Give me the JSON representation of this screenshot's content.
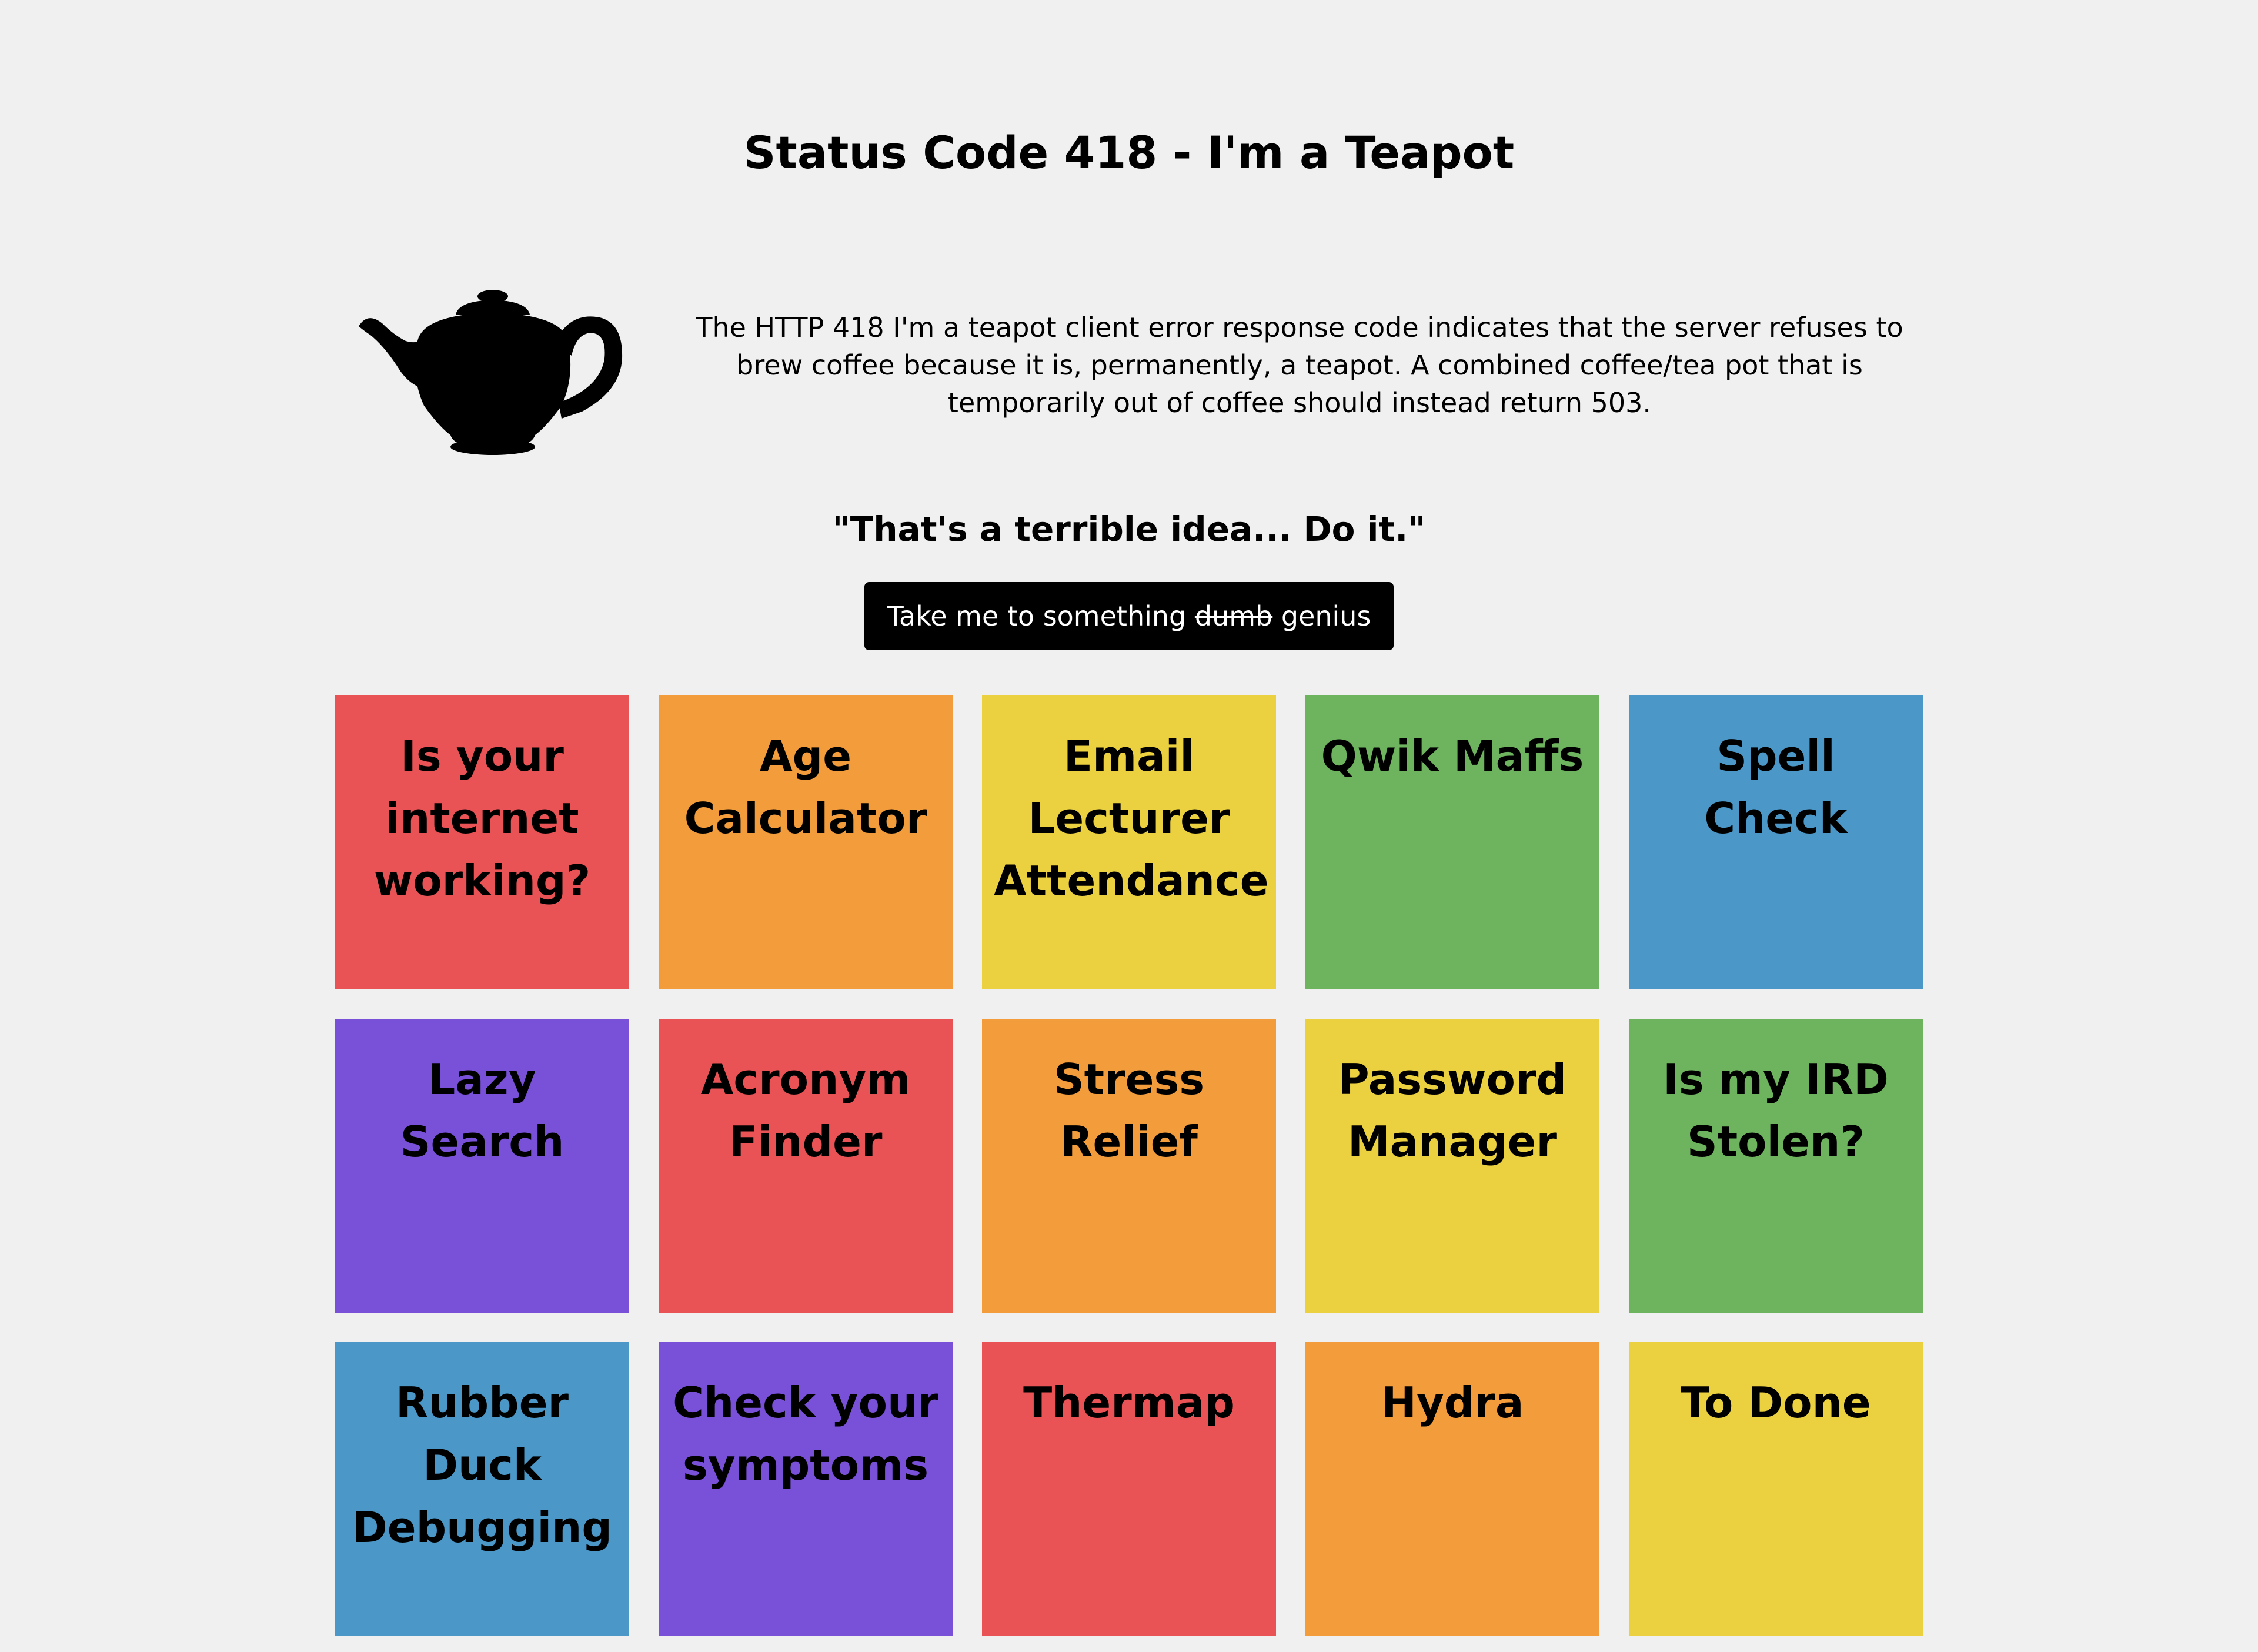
{
  "header": {
    "title": "Status Code 418 - I'm a Teapot"
  },
  "intro": {
    "image_icon": "teapot-icon",
    "description": "The HTTP 418 I'm a teapot client error response code indicates that the server refuses to brew coffee because it is, permanently, a teapot. A combined coffee/tea pot that is temporarily out of coffee should instead return 503."
  },
  "quote": "\"That's a terrible idea... Do it.\"",
  "cta": {
    "prefix": "Take me to something",
    "struck": "dumb",
    "suffix": "genius"
  },
  "colors": {
    "background": "#f0f0f0",
    "red": "#e95356",
    "orange": "#f39c3c",
    "yellow": "#ebd13f",
    "green": "#6eb45f",
    "blue": "#4a97c8",
    "purple": "#7950d8",
    "button": "#000000"
  },
  "tiles": [
    {
      "label": "Is your internet working?",
      "color": "#e95356"
    },
    {
      "label": "Age Calculator",
      "color": "#f39c3c"
    },
    {
      "label": "Email Lecturer Attendance",
      "color": "#ebd13f"
    },
    {
      "label": "Qwik Maffs",
      "color": "#6eb45f"
    },
    {
      "label": "Spell Check",
      "color": "#4a97c8"
    },
    {
      "label": "Lazy Search",
      "color": "#7950d8"
    },
    {
      "label": "Acronym Finder",
      "color": "#e95356"
    },
    {
      "label": "Stress Relief",
      "color": "#f39c3c"
    },
    {
      "label": "Password Manager",
      "color": "#ebd13f"
    },
    {
      "label": "Is my IRD Stolen?",
      "color": "#6eb45f"
    },
    {
      "label": "Rubber Duck Debugging",
      "color": "#4a97c8"
    },
    {
      "label": "Check your symptoms",
      "color": "#7950d8"
    },
    {
      "label": "Thermap",
      "color": "#e95356"
    },
    {
      "label": "Hydra",
      "color": "#f39c3c"
    },
    {
      "label": "To Done",
      "color": "#ebd13f"
    }
  ]
}
